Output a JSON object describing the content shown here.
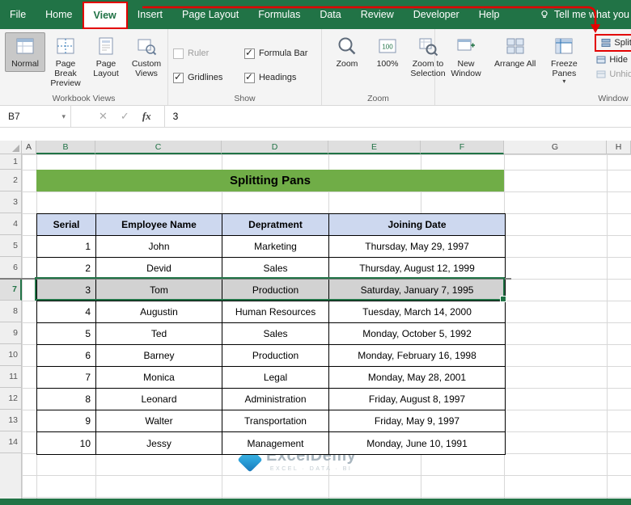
{
  "colors": {
    "excel_green": "#217346",
    "banner_green": "#70ad47",
    "table_header_fill": "#cdd8ef",
    "selection_fill": "#d2d2d2",
    "annotation_red": "#e30000"
  },
  "tabs": {
    "items": [
      "File",
      "Home",
      "View",
      "Insert",
      "Page Layout",
      "Formulas",
      "Data",
      "Review",
      "Developer",
      "Help"
    ],
    "active": "View",
    "tell_me": "Tell me what you"
  },
  "ribbon": {
    "workbook_views": {
      "label": "Workbook Views",
      "normal": "Normal",
      "page_break_preview": "Page Break Preview",
      "page_layout": "Page Layout",
      "custom_views": "Custom Views"
    },
    "show": {
      "label": "Show",
      "ruler": "Ruler",
      "formula_bar": "Formula Bar",
      "gridlines": "Gridlines",
      "headings": "Headings"
    },
    "zoom": {
      "label": "Zoom",
      "zoom": "Zoom",
      "hundred": "100%",
      "zoom_to_selection": "Zoom to Selection"
    },
    "window": {
      "label": "Window",
      "new_window": "New Window",
      "arrange_all": "Arrange All",
      "freeze_panes": "Freeze Panes",
      "split": "Split",
      "hide": "Hide",
      "unhide": "Unhide"
    }
  },
  "formula_bar": {
    "name_box": "B7",
    "fx": "fx",
    "value": "3"
  },
  "sheet": {
    "columns": [
      "A",
      "B",
      "C",
      "D",
      "E",
      "F",
      "G",
      "H"
    ],
    "row_numbers": [
      "1",
      "2",
      "3",
      "4",
      "5",
      "6",
      "7",
      "8",
      "9",
      "10",
      "11",
      "12",
      "13",
      "14"
    ]
  },
  "table": {
    "title": "Splitting Pans",
    "headers": [
      "Serial",
      "Employee Name",
      "Depratment",
      "Joining Date"
    ],
    "rows": [
      {
        "serial": "1",
        "name": "John",
        "dept": "Marketing",
        "date": "Thursday, May 29, 1997"
      },
      {
        "serial": "2",
        "name": "Devid",
        "dept": "Sales",
        "date": "Thursday, August 12, 1999"
      },
      {
        "serial": "3",
        "name": "Tom",
        "dept": "Production",
        "date": "Saturday, January 7, 1995"
      },
      {
        "serial": "4",
        "name": "Augustin",
        "dept": "Human Resources",
        "date": "Tuesday, March 14, 2000"
      },
      {
        "serial": "5",
        "name": "Ted",
        "dept": "Sales",
        "date": "Monday, October 5, 1992"
      },
      {
        "serial": "6",
        "name": "Barney",
        "dept": "Production",
        "date": "Monday, February 16, 1998"
      },
      {
        "serial": "7",
        "name": "Monica",
        "dept": "Legal",
        "date": "Monday, May 28, 2001"
      },
      {
        "serial": "8",
        "name": "Leonard",
        "dept": "Administration",
        "date": "Friday, August 8, 1997"
      },
      {
        "serial": "9",
        "name": "Walter",
        "dept": "Transportation",
        "date": "Friday, May 9, 1997"
      },
      {
        "serial": "10",
        "name": "Jessy",
        "dept": "Management",
        "date": "Monday, June 10, 1991"
      }
    ]
  },
  "watermark": {
    "brand": "ExcelDemy",
    "tagline": "EXCEL · DATA · BI"
  }
}
